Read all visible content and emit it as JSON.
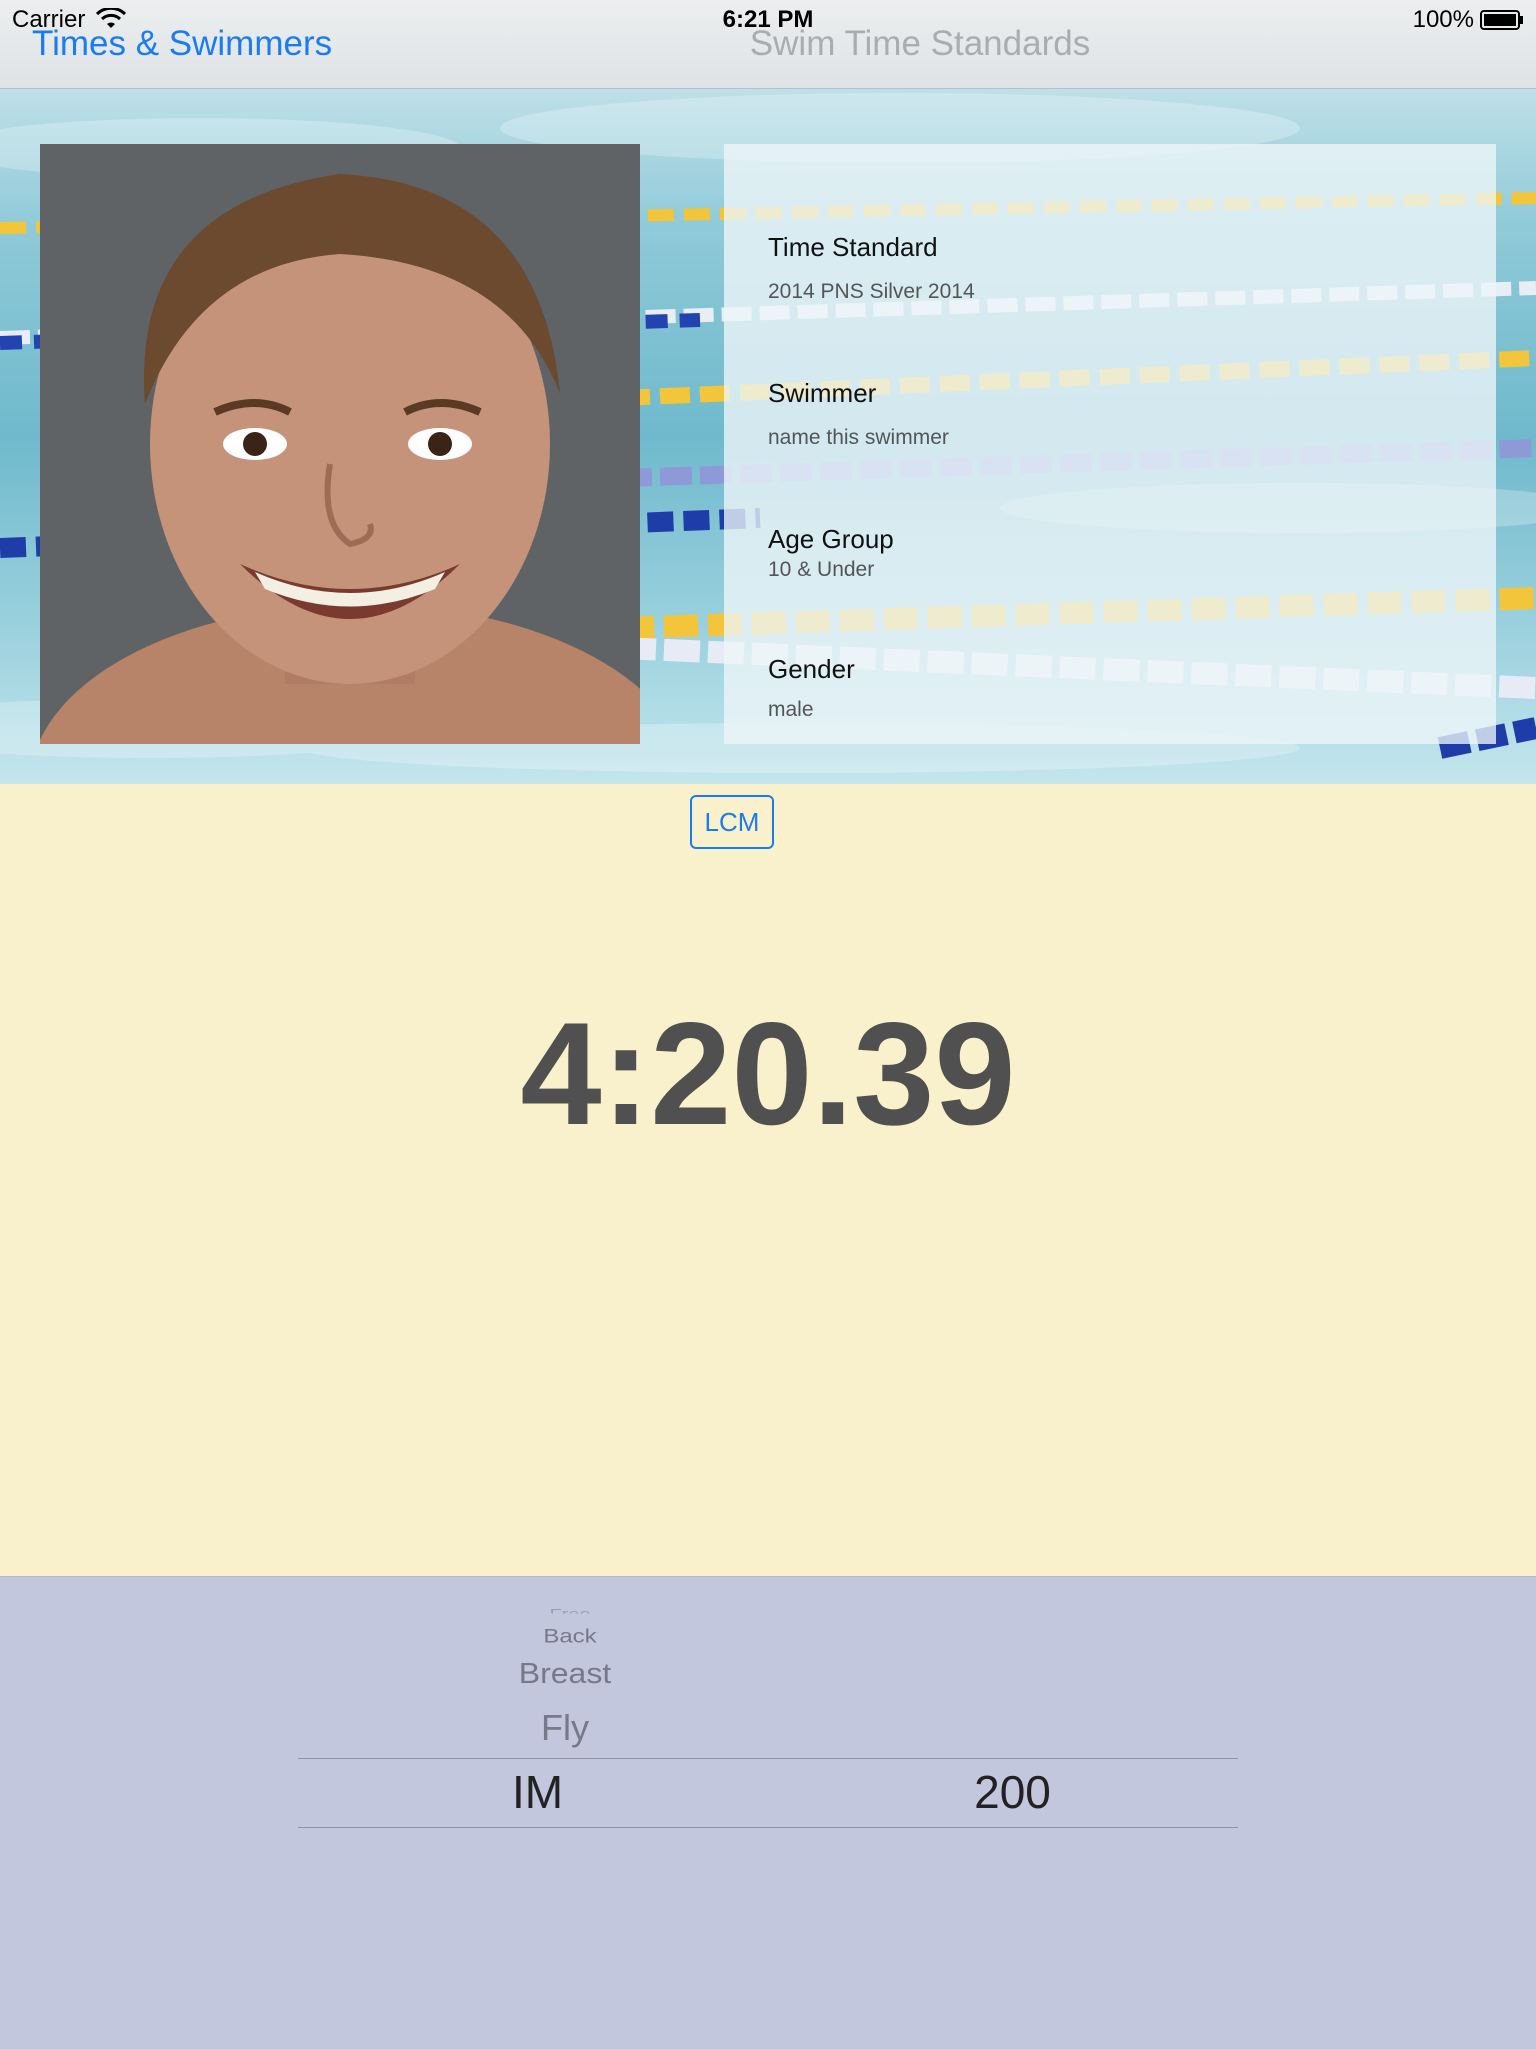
{
  "status_bar": {
    "carrier": "Carrier",
    "time": "6:21 PM",
    "battery": "100%"
  },
  "nav": {
    "back_label": "Times & Swimmers",
    "title": "Swim Time Standards"
  },
  "info": {
    "time_standard_label": "Time Standard",
    "time_standard_value": "2014 PNS Silver 2014",
    "swimmer_label": "Swimmer",
    "swimmer_value": "name this swimmer",
    "age_group_label": "Age Group",
    "age_group_value": "10 & Under",
    "gender_label": "Gender",
    "gender_value": "male"
  },
  "course_button": "LCM",
  "standard_time": "4:20.39",
  "picker": {
    "strokes": [
      "Free",
      "Back",
      "Breast",
      "Fly"
    ],
    "selected_stroke": "IM",
    "selected_distance": "200"
  },
  "colors": {
    "accent": "#1a7cf0",
    "main_bg": "#f8f1cb",
    "picker_bg": "#c3c7dd",
    "time_text": "#505050"
  }
}
